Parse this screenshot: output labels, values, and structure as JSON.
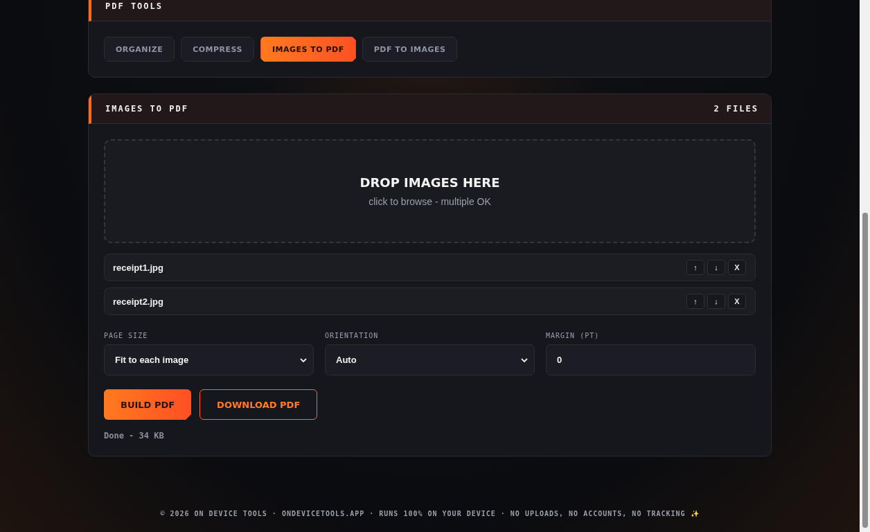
{
  "tools_panel": {
    "title": "PDF TOOLS",
    "tabs": [
      {
        "label": "ORGANIZE",
        "selected": false
      },
      {
        "label": "COMPRESS",
        "selected": false
      },
      {
        "label": "IMAGES TO PDF",
        "selected": true
      },
      {
        "label": "PDF TO IMAGES",
        "selected": false
      }
    ]
  },
  "images_panel": {
    "title": "IMAGES TO PDF",
    "count": "2 FILES",
    "dropzone": {
      "title": "DROP IMAGES HERE",
      "hint": "click to browse - multiple OK"
    },
    "files": [
      {
        "name": "receipt1.jpg",
        "up": "↑",
        "down": "↓",
        "remove": "X"
      },
      {
        "name": "receipt2.jpg",
        "up": "↑",
        "down": "↓",
        "remove": "X"
      }
    ],
    "fields": [
      {
        "kind": "select",
        "label": "PAGE SIZE",
        "value": "Fit to each image"
      },
      {
        "kind": "select",
        "label": "ORIENTATION",
        "value": "Auto"
      },
      {
        "kind": "input",
        "label": "MARGIN (PT)",
        "value": "0"
      }
    ],
    "buttons": [
      {
        "kind": "primary",
        "label": "BUILD PDF"
      },
      {
        "kind": "outline",
        "label": "DOWNLOAD PDF"
      }
    ],
    "status": "Done - 34 KB"
  },
  "footer": "© 2026 ON DEVICE TOOLS · ONDEVICETOOLS.APP · RUNS 100% ON YOUR DEVICE · NO UPLOADS, NO ACCOUNTS, NO TRACKING ✨"
}
